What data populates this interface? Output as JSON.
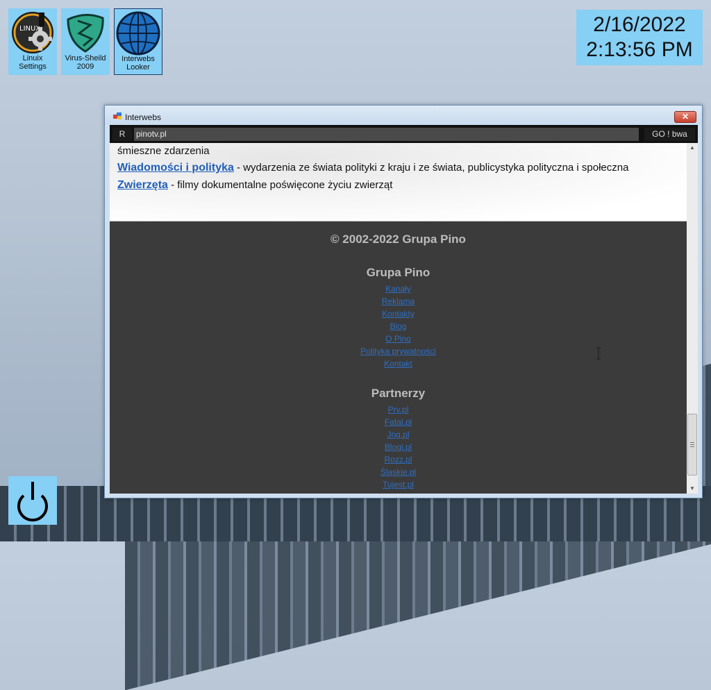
{
  "desktop": {
    "icons": [
      {
        "label": "Linuix\nSettings",
        "icon": "linux-settings-icon"
      },
      {
        "label": "Virus-Sheild\n2009",
        "icon": "shield-icon"
      },
      {
        "label": "Interwebs\nLooker",
        "icon": "globe-icon"
      }
    ],
    "clock": {
      "date": "2/16/2022",
      "time": "2:13:56 PM"
    }
  },
  "window": {
    "title": "Interwebs",
    "close_label": "✕",
    "reload_label": "R",
    "url": "pinotv.pl",
    "go_label": "GO ! bwa"
  },
  "page": {
    "lines": [
      {
        "text": "śmieszne zdarzenia"
      },
      {
        "link": "Wiadomości i polityka",
        "text": " - wydarzenia ze świata polityki z kraju i ze świata, publicystyka polityczna i społeczna"
      },
      {
        "link": "Zwierzęta",
        "text": " - filmy dokumentalne poświęcone życiu zwierząt"
      }
    ],
    "footer": {
      "copyright": "© 2002-2022 Grupa Pino",
      "group_title": "Grupa Pino",
      "group_links": [
        "Kanały",
        "Reklama",
        "Kontakty",
        "Blog",
        "O Pino",
        "Polityka prywatności",
        "Kontakt"
      ],
      "partners_title": "Partnerzy",
      "partner_links": [
        "Prv.pl",
        "Fatal.pl",
        "Jng.pl",
        "Blogi.pl",
        "Rozz.pl",
        "Śląskie.pl",
        "Tujest.pl"
      ]
    }
  }
}
